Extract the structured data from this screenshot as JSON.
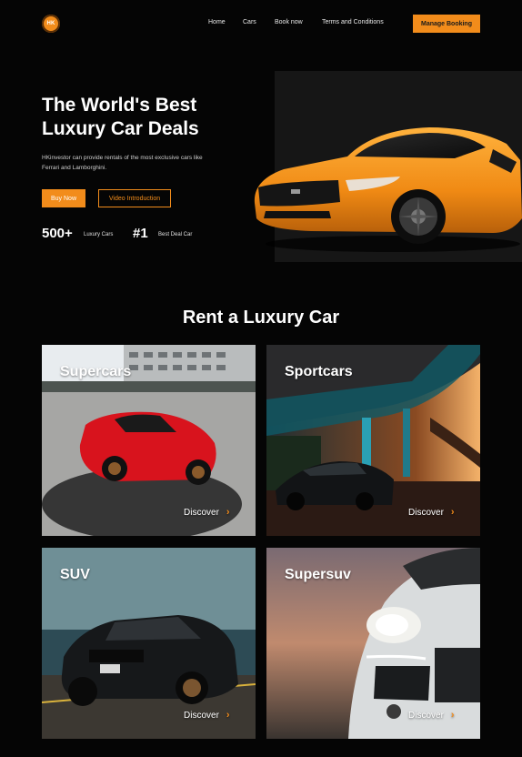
{
  "nav": {
    "logo_text": "HK",
    "links": [
      "Home",
      "Cars",
      "Book now",
      "Terms and Conditions"
    ],
    "cta": "Manage Booking"
  },
  "hero": {
    "title_line1": "The World's Best",
    "title_line2": "Luxury Car Deals",
    "description": "HKinvestor can provide rentals of the most exclusive cars like Ferrari and Lamborghini.",
    "buy_button": "Buy Now",
    "video_button": "Video Introduction",
    "stats": [
      {
        "value": "500+",
        "label": "Luxury Cars"
      },
      {
        "value": "#1",
        "label": "Best Deal Car"
      }
    ]
  },
  "section": {
    "title": "Rent a Luxury Car",
    "cards": [
      {
        "title": "Supercars",
        "action": "Discover"
      },
      {
        "title": "Sportcars",
        "action": "Discover"
      },
      {
        "title": "SUV",
        "action": "Discover"
      },
      {
        "title": "Supersuv",
        "action": "Discover"
      }
    ]
  },
  "colors": {
    "accent": "#f28c1b",
    "background": "#050505"
  },
  "icons": {
    "discover": "chevron-right-icon"
  }
}
